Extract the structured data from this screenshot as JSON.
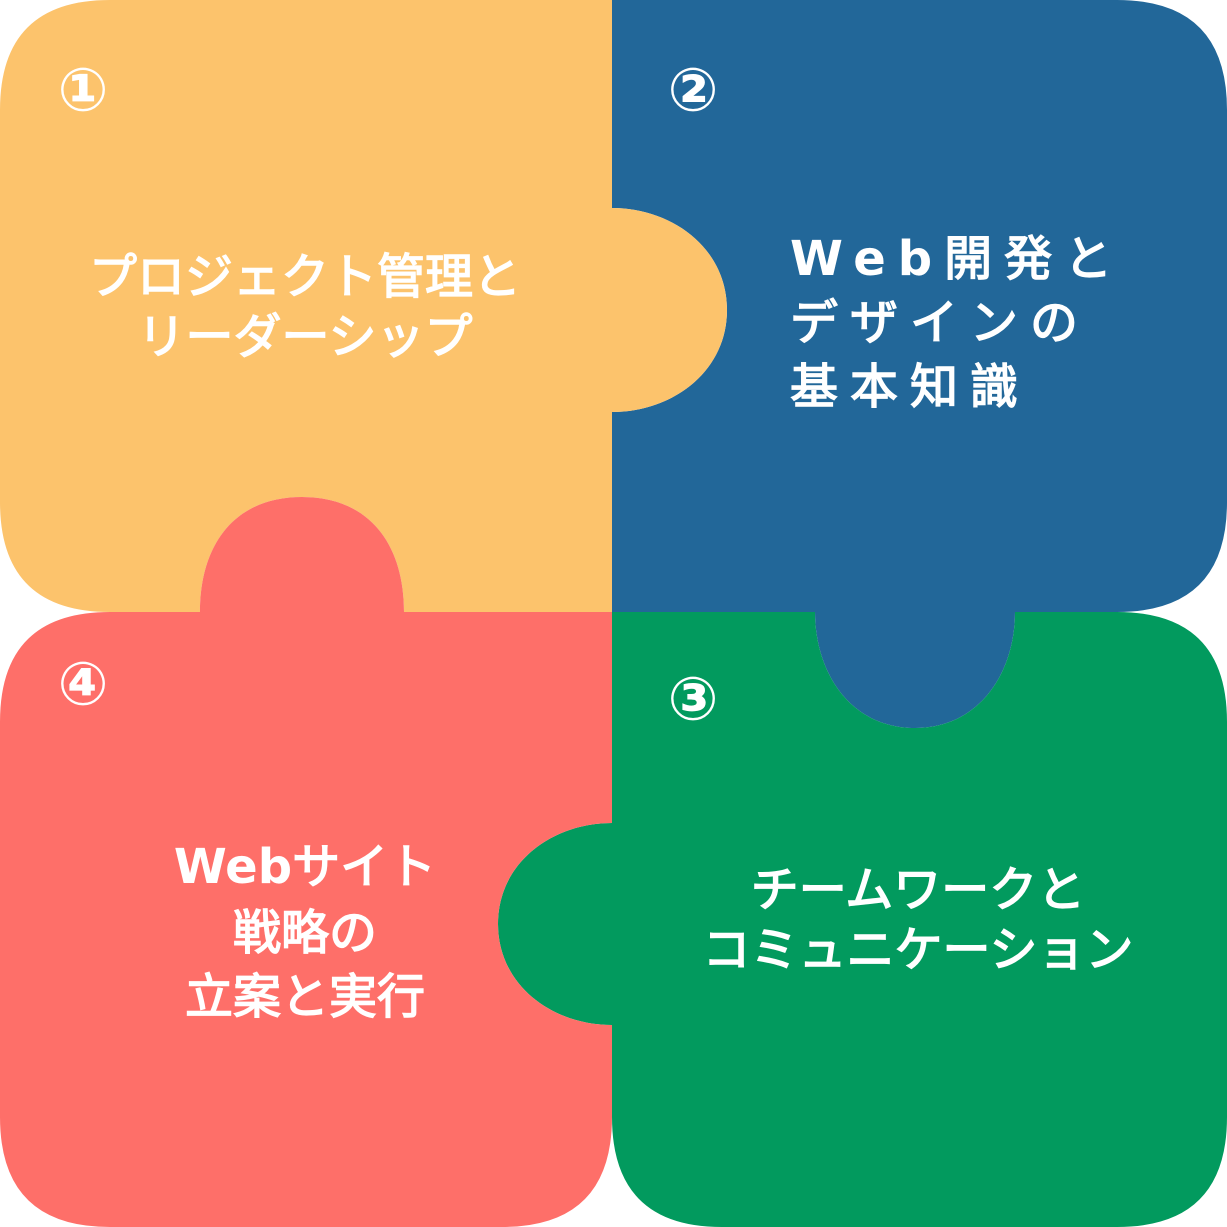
{
  "colors": {
    "piece_1": "#FCC36C",
    "piece_2": "#226799",
    "piece_3": "#029A5E",
    "piece_4": "#FE6F69",
    "text": "#FFFFFF"
  },
  "pieces": [
    {
      "number": "①",
      "lines": [
        "プロジェクト管理と",
        "リーダーシップ"
      ]
    },
    {
      "number": "②",
      "lines": [
        "Web開発と",
        "デザインの",
        "基本知識"
      ]
    },
    {
      "number": "③",
      "lines": [
        "チームワークと",
        "コミュニケーション"
      ]
    },
    {
      "number": "④",
      "lines": [
        "Webサイト",
        "戦略の",
        "立案と実行"
      ]
    }
  ]
}
